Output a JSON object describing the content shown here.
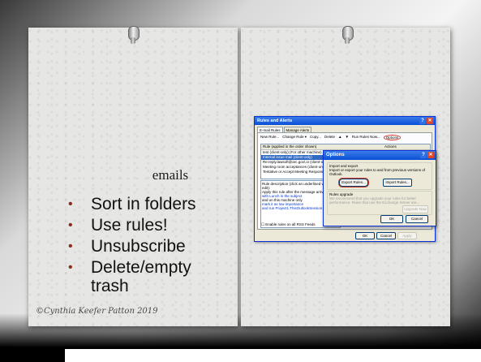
{
  "slide": {
    "title": "emails",
    "bullets": [
      "Sort in folders",
      "Use rules!",
      "Unsubscribe",
      "Delete/empty trash"
    ],
    "credit": "©Cynthia Keefer Patton 2019"
  },
  "rules_dialog": {
    "title": "Rules and Alerts",
    "tabs": [
      "E-mail Rules",
      "Manage Alerts"
    ],
    "toolbar": [
      "New Rule...",
      "Change Rule ▾",
      "Copy...",
      "Delete",
      "▲",
      "▼",
      "Run Rules Now...",
      "Options"
    ],
    "columns": [
      "Rule (applied in the order shown)",
      "Actions"
    ],
    "rules": [
      "Rule (applied in the order shown)",
      "test (client-only) (For other machine)",
      "Internal issue mail (client-only)",
      "Re:reply.lawsoft@arc.gov\\.io (client-only)",
      "Meeting room acceptances (client-only)",
      "Tentative or Accept Meeting Response (cli..."
    ],
    "description_label": "Rule description (click an underlined value to edit):",
    "description_lines": [
      "Apply this rule after the message arrives",
      "with Lunch in the subject",
      "and on this machine only",
      "mark it as low importance",
      "and run Project1.ThisOutlookSession.Remove"
    ],
    "checkbox": "Enable rules on all RSS Feeds",
    "buttons": [
      "OK",
      "Cancel",
      "Apply"
    ]
  },
  "options_dialog": {
    "title": "Options",
    "group1_title": "Import and export",
    "group1_text": "Import or export your rules to and from previous versions of Outlook.",
    "export_button": "Export Rules...",
    "import_button": "Import Rules...",
    "group2_title": "Rules upgrade",
    "group2_text": "We recommend that you upgrade your rules for better performance. Rules that use the Exchange Server are...",
    "upgrade_button": "Upgrade Now",
    "ok": "OK",
    "cancel": "Cancel"
  },
  "colors": {
    "xp_title": "#0a4fd6",
    "bullet": "#8b2b1c",
    "highlight_circle": "#d03a2a"
  }
}
